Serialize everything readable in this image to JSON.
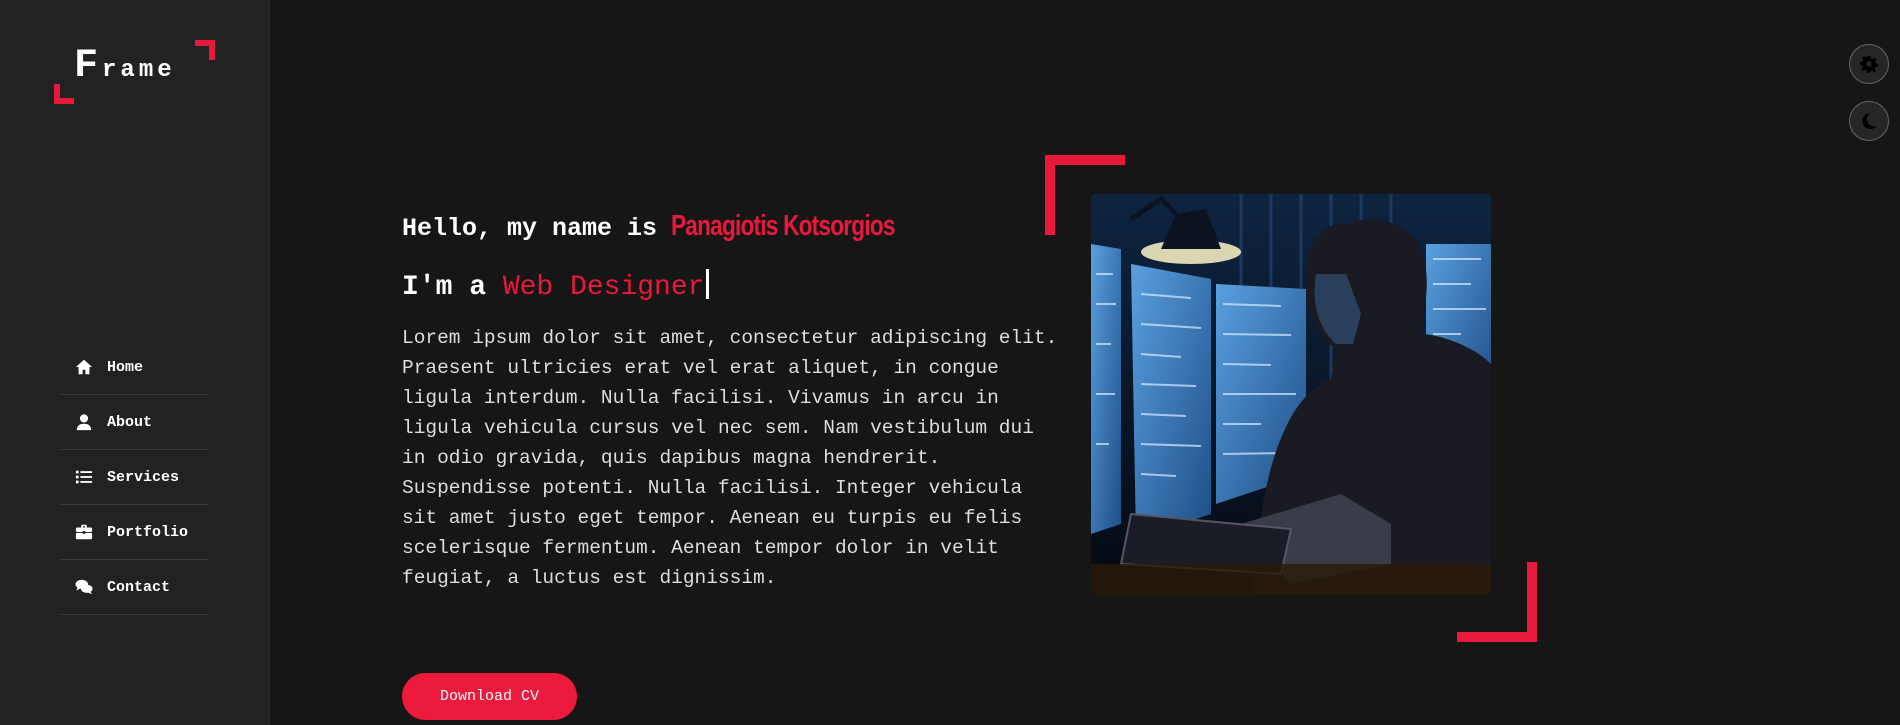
{
  "logo": {
    "text_first": "F",
    "text_rest": "rame",
    "accent": "#e8193c"
  },
  "nav": {
    "items": [
      {
        "label": "Home",
        "icon": "home-icon"
      },
      {
        "label": "About",
        "icon": "user-icon"
      },
      {
        "label": "Services",
        "icon": "list-icon"
      },
      {
        "label": "Portfolio",
        "icon": "briefcase-icon"
      },
      {
        "label": "Contact",
        "icon": "comments-icon"
      }
    ]
  },
  "hero": {
    "greeting": "Hello, my name is",
    "name": "Panagiotis Kotsorgios",
    "role_prefix": "I'm a",
    "role": "Web Designer",
    "paragraph": "Lorem ipsum dolor sit amet, consectetur adipiscing elit. Praesent ultricies erat vel erat aliquet, in congue ligula interdum. Nulla facilisi. Vivamus in arcu in ligula vehicula cursus vel nec sem. Nam vestibulum dui in odio gravida, quis dapibus magna hendrerit. Suspendisse potenti. Nulla facilisi. Integer vehicula sit amet justo eget tempor. Aenean eu turpis eu felis scelerisque fermentum. Aenean tempor dolor in velit feugiat, a luctus est dignissim.",
    "download_label": "Download CV"
  },
  "controls": {
    "settings_icon": "gear-icon",
    "theme_icon": "moon-icon"
  },
  "colors": {
    "accent": "#e8193c",
    "sidebar": "#222222",
    "background": "#161616"
  }
}
